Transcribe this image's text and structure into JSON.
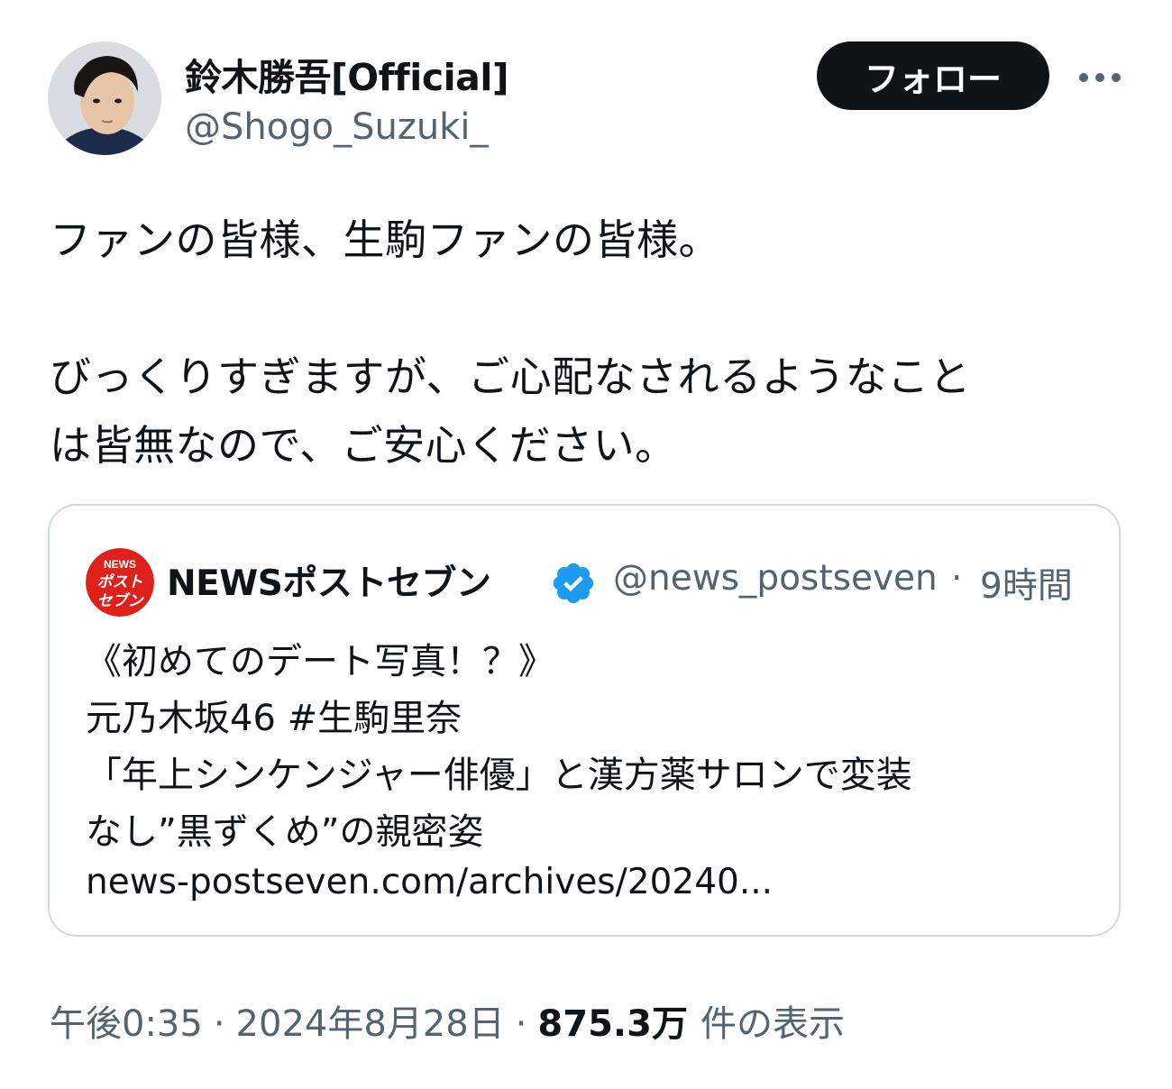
{
  "author": {
    "display_name": "鈴木勝吾[Official]",
    "handle": "@Shogo_Suzuki_",
    "follow_label": "フォロー",
    "more_icon": "more-horizontal-icon"
  },
  "post": {
    "lines": [
      "ファンの皆様、生駒ファンの皆様。",
      "びっくりすぎますが、ご心配なされるようなこと",
      "は皆無なので、ご安心ください。"
    ]
  },
  "quoted_post": {
    "logo_text": "NEWSポストセブン",
    "display_name": "NEWSポストセブン",
    "verified_icon": "verified-badge-icon",
    "handle": "@news_postseven",
    "separator": "·",
    "time": "9時間",
    "lines": [
      "《初めてのデート写真！？》",
      "元乃木坂46 #生駒里奈",
      "「年上シンケンジャー俳優」と漢方薬サロンで変装",
      "なし”黒ずくめ”の親密姿",
      "news-postseven.com/archives/20240..."
    ]
  },
  "meta": {
    "time": "午後0:35",
    "separator": "·",
    "date": "2024年8月28日",
    "views_count": "875.3万",
    "views_label": "件の表示"
  },
  "colors": {
    "primary_text": "#0f1419",
    "secondary_text": "#536471",
    "border": "#cfd9de",
    "verified": "#1d9bf0",
    "news_logo_red": "#e0201b"
  }
}
